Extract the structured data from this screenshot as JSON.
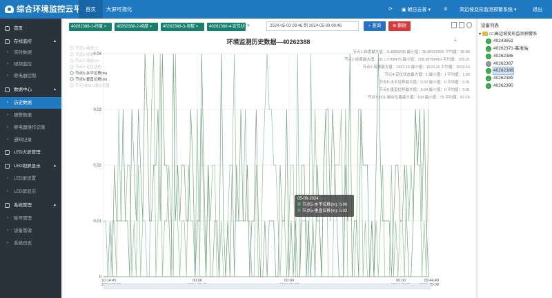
{
  "header": {
    "app_title": "综合环境监控云平台",
    "nav": [
      "首页",
      "大屏可视化"
    ],
    "org": "朝日吉普",
    "system": "高边坡变形监测预警系统",
    "logout": "退出"
  },
  "sidebar": {
    "items": [
      {
        "label": "首页",
        "type": "group"
      },
      {
        "label": "在线监控",
        "type": "group"
      },
      {
        "label": "实时数据",
        "type": "sub"
      },
      {
        "label": "视频监控",
        "type": "sub"
      },
      {
        "label": "继电器控制",
        "type": "sub"
      },
      {
        "label": "数据中心",
        "type": "group"
      },
      {
        "label": "历史数据",
        "type": "sub",
        "active": true
      },
      {
        "label": "报警数据",
        "type": "sub"
      },
      {
        "label": "继电器操作记录",
        "type": "sub"
      },
      {
        "label": "通知记录",
        "type": "sub"
      },
      {
        "label": "LED大屏管理",
        "type": "group"
      },
      {
        "label": "LED视屏显示",
        "type": "group"
      },
      {
        "label": "LED屏设置",
        "type": "sub"
      },
      {
        "label": "LED屏显示",
        "type": "sub"
      },
      {
        "label": "系统管理",
        "type": "group"
      },
      {
        "label": "账号管理",
        "type": "sub"
      },
      {
        "label": "设备管理",
        "type": "sub"
      },
      {
        "label": "系统日志",
        "type": "sub"
      }
    ]
  },
  "toolbar": {
    "tags": [
      "40262388-1-纬度",
      "40262388-2-经度",
      "40262388-3-海拔",
      "40262388-4-定位状"
    ],
    "date_range": "2024-05-03 09:46 到 2024-05-09 09:46",
    "query_label": "查询",
    "delete_label": "删除"
  },
  "chart_data": {
    "type": "line",
    "title": "环境监测历史数据—40262388",
    "legend_left": [
      "节点1-纬度(°)",
      "节点2-经度(°)",
      "节点3-海拔(m)",
      "节点4-定位状态",
      "节点5-水平位移(m)",
      "节点6-垂直位移(m)",
      "节点10001-融合位置"
    ],
    "stats": [
      "节点1-纬度最大值：3□8959295  最小值：36.85592926  平均值：36.80",
      "节点2-经度最大值：10□□7768475  最小值：108.30768451  平均值：108.31",
      "节点3-海拔最大值：1523.16  最小值：1523.16  平均值：1523.16",
      "节点4-定位状态最大值：1  最小值：1  平均值：1.00",
      "节点5-水平位移最大值：0.02  最小值：0  平均值：0.01",
      "节点6-垂直位移最大值：0.04  最小值：0  平均值：0.01",
      "节点10001-融合位置最大值：100  最小值：75  平均值：97.74"
    ],
    "y_ticks": [
      "0",
      "0.01",
      "0.02",
      "0.03",
      "0.04"
    ],
    "ylim": [
      0,
      0.04
    ],
    "x_ticks": [
      {
        "t": "10:14:45",
        "d": "2024-05-03"
      },
      {
        "t": "00:00",
        "d": "2024-05-05"
      },
      {
        "t": "00:00",
        "d": "2024-05-07"
      },
      {
        "t": "00:00",
        "d": "2024-05-09"
      },
      {
        "t": "09:44:49",
        "d": "2024-05-09"
      }
    ],
    "series": [
      {
        "name": "节点5-水平位移(m)",
        "color": "#7fb48f"
      },
      {
        "name": "节点6-垂直位移(m)",
        "color": "#5e8f72"
      }
    ]
  },
  "tooltip": {
    "date": "05-06-2024",
    "rows": [
      "节点5-水平位移(m): 0.00",
      "节点6-垂直位移(m): 0.02"
    ]
  },
  "device_panel": {
    "title": "设备列表",
    "root": "□□高边坡变形监测预警系",
    "devices": [
      {
        "id": "40243652",
        "status": "online"
      },
      {
        "id": "40262371-基准站",
        "status": "online"
      },
      {
        "id": "40262386",
        "status": "online"
      },
      {
        "id": "40262387",
        "status": "offline"
      },
      {
        "id": "40262388",
        "status": "online",
        "selected": true
      },
      {
        "id": "40262389",
        "status": "online"
      },
      {
        "id": "40262390",
        "status": "online"
      }
    ]
  }
}
